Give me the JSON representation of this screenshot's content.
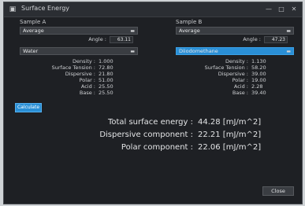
{
  "window": {
    "title": "Surface Energy",
    "icon": "app-icon",
    "buttons": [
      "—",
      "□",
      "✕"
    ]
  },
  "left": {
    "label": "Sample A",
    "liquid_select": "Average",
    "angle_label": "Angle :",
    "angle_value": "63.11",
    "solid_select": "Water",
    "props": [
      {
        "label": "Density :",
        "value": "1.000"
      },
      {
        "label": "Surface Tension :",
        "value": "72.80"
      },
      {
        "label": "Dispersive :",
        "value": "21.80"
      },
      {
        "label": "Polar :",
        "value": "51.00"
      },
      {
        "label": "Acid :",
        "value": "25.50"
      },
      {
        "label": "Base :",
        "value": "25.50"
      }
    ]
  },
  "right": {
    "label": "Sample B",
    "liquid_select": "Average",
    "angle_label": "Angle :",
    "angle_value": "47.23",
    "solid_select": "Diiodomethane",
    "props": [
      {
        "label": "Density :",
        "value": "1.130"
      },
      {
        "label": "Surface Tension :",
        "value": "58.20"
      },
      {
        "label": "Dispersive :",
        "value": "39.00"
      },
      {
        "label": "Polar :",
        "value": "19.00"
      },
      {
        "label": "Acid :",
        "value": "2.28"
      },
      {
        "label": "Base :",
        "value": "39.40"
      }
    ]
  },
  "calc_button": "Calculate",
  "results": [
    {
      "label": "Total surface energy :",
      "value": "44.28 [mJ/m^2]"
    },
    {
      "label": "Dispersive component :",
      "value": "22.21 [mJ/m^2]"
    },
    {
      "label": "Polar component :",
      "value": "22.06 [mJ/m^2]"
    }
  ],
  "close_button": "Close",
  "colors": {
    "accent": "#2a8fd6",
    "background": "#1e2024"
  }
}
